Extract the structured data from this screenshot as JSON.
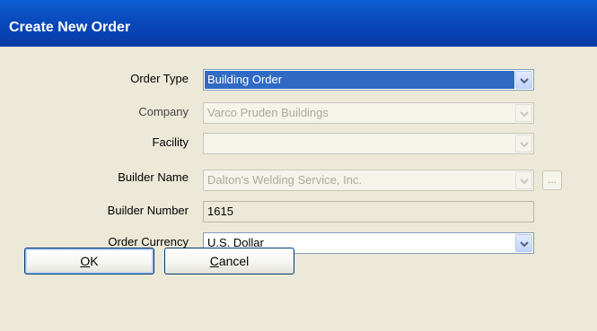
{
  "window": {
    "title": "Create New Order"
  },
  "form": {
    "order_type": {
      "label": "Order Type",
      "value": "Building Order"
    },
    "company": {
      "label": "Company",
      "value": "Varco Pruden Buildings"
    },
    "facility": {
      "label": "Facility",
      "value": ""
    },
    "builder_name": {
      "label": "Builder Name",
      "value": "Dalton's Welding Service, Inc.",
      "browse_label": "..."
    },
    "builder_number": {
      "label": "Builder Number",
      "value": "1615"
    },
    "order_currency": {
      "label": "Order Currency",
      "value": "U.S. Dollar"
    }
  },
  "buttons": {
    "ok": {
      "mnemonic": "O",
      "rest": "K"
    },
    "cancel": {
      "mnemonic": "C",
      "rest": "ancel"
    }
  },
  "colors": {
    "titlebar": "#0846b8",
    "dialog_bg": "#ece9d8",
    "selection": "#316ac5"
  }
}
